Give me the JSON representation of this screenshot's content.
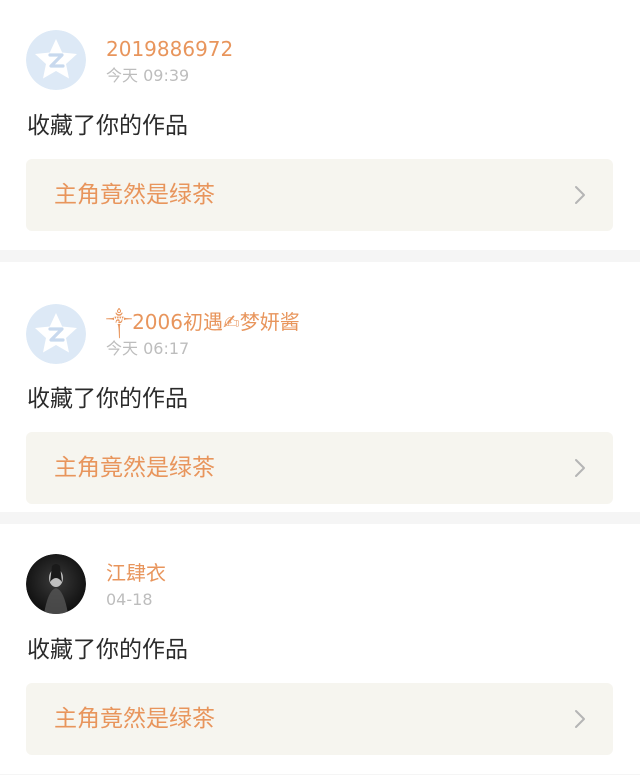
{
  "notifications": [
    {
      "avatar_icon": "qq-star-default-avatar",
      "username": "2019886972",
      "time": "今天 09:39",
      "action": "收藏了你的作品",
      "work_title": "主角竟然是绿茶"
    },
    {
      "avatar_icon": "qq-star-default-avatar",
      "username": "༒2006初遇✍梦妍酱",
      "time": "今天 06:17",
      "action": "收藏了你的作品",
      "work_title": "主角竟然是绿茶"
    },
    {
      "avatar_icon": "dark-photo-avatar",
      "username": "江肆衣",
      "time": "04-18",
      "action": "收藏了你的作品",
      "work_title": "主角竟然是绿茶"
    }
  ],
  "colors": {
    "accent": "#e8955c",
    "timestamp": "#bdbdbd",
    "text": "#2b2b2b",
    "work_box_bg": "#f6f5ef",
    "page_bg": "#f5f5f5"
  }
}
